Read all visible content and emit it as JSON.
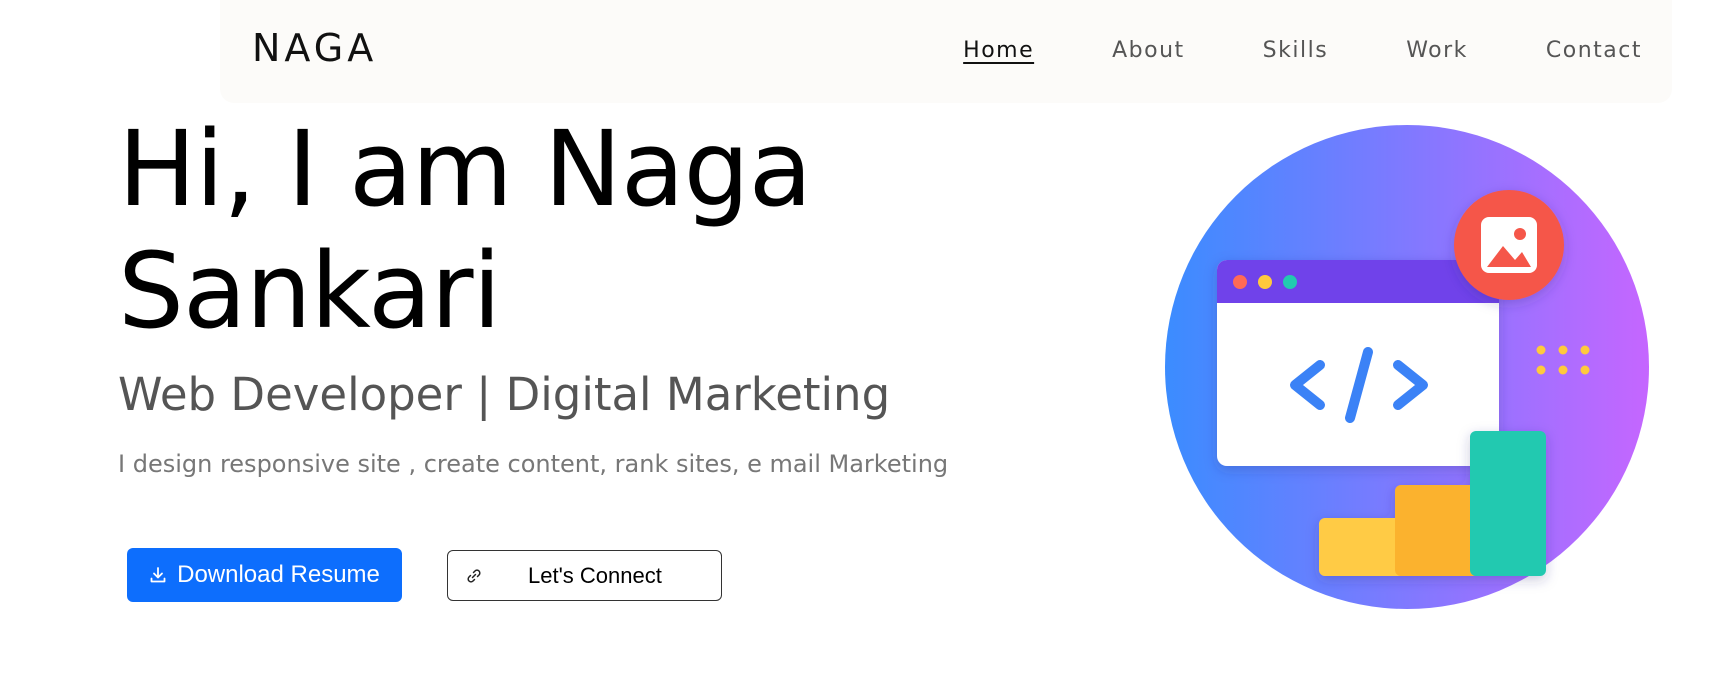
{
  "nav": {
    "brand": "NAGA",
    "links": [
      {
        "label": "Home",
        "active": true
      },
      {
        "label": "About",
        "active": false
      },
      {
        "label": "Skills",
        "active": false
      },
      {
        "label": "Work",
        "active": false
      },
      {
        "label": "Contact",
        "active": false
      }
    ]
  },
  "hero": {
    "title_line1": "Hi, I am Naga",
    "title_line2": "Sankari",
    "subtitle": "Web Developer | Digital Marketing",
    "description": "I design responsive site , create content, rank sites, e mail Marketing",
    "primary_button": {
      "label": "Download Resume",
      "icon": "download-icon"
    },
    "secondary_button": {
      "label": "Let's Connect",
      "icon": "link-icon"
    }
  },
  "illustration": {
    "icons": [
      "code-window-icon",
      "image-icon",
      "bar-chart-icon"
    ],
    "colors": {
      "gradient_start": "#3b8cff",
      "gradient_end": "#c566ff",
      "window_bar": "#7043ea",
      "code": "#3b82f6",
      "image_badge": "#f5574a",
      "bar1": "#ffcb45",
      "bar2": "#fbb22e",
      "bar3": "#23c9b0"
    }
  }
}
